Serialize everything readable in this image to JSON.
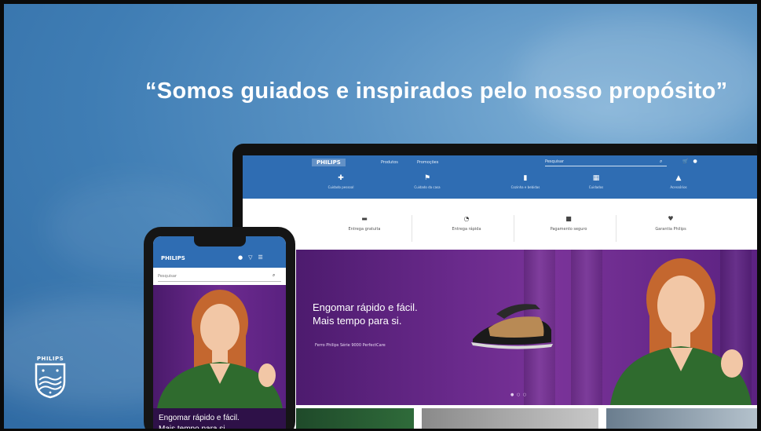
{
  "headline": "“Somos guiados e inspirados pelo nosso propósito”",
  "brand": {
    "name": "PHILIPS",
    "accent": "#2f6db3",
    "hero": "#6a2a8c"
  },
  "laptop": {
    "logo": "PHILIPS",
    "nav": [
      "Produtos",
      "Promoções"
    ],
    "search_placeholder": "Pesquisar",
    "categories": [
      {
        "label": "Cuidado pessoal",
        "icon": "person-icon"
      },
      {
        "label": "Cuidado da casa",
        "icon": "home-icon"
      },
      {
        "label": "Cozinha e bebidas",
        "icon": "bottle-icon"
      },
      {
        "label": "Cuidados",
        "icon": "grid-icon"
      },
      {
        "label": "Acessórios",
        "icon": "bag-icon"
      }
    ],
    "subnav": [
      "Entrega gratuita",
      "Entrega rápida",
      "Pagamento seguro",
      "Garantia Philips"
    ],
    "hero": {
      "line1": "Engomar rápido e fácil.",
      "line2": "Mais tempo para si.",
      "sub": "Ferro Philips Série 9000 PerfectCare",
      "dots": "● ○ ○"
    }
  },
  "phone": {
    "logo": "PHILIPS",
    "search_placeholder": "Pesquisar",
    "caption_line1": "Engomar rápido e fácil.",
    "caption_line2": "Mais tempo para si."
  }
}
